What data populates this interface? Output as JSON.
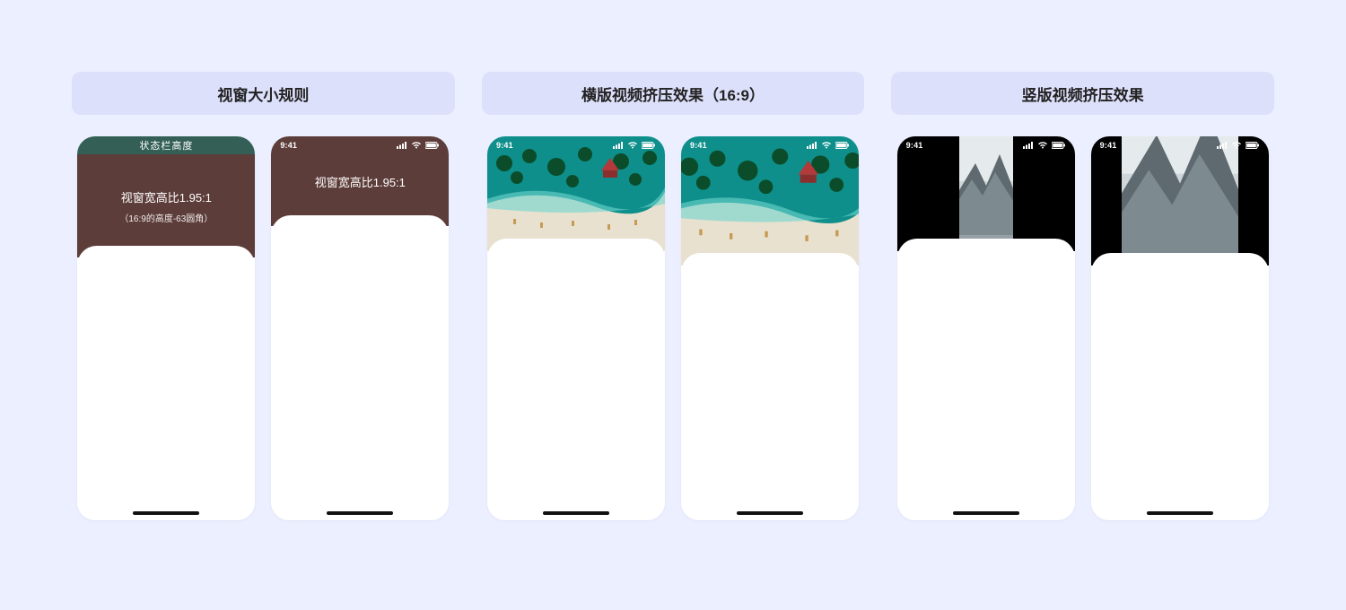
{
  "status_time": "9:41",
  "columns": [
    {
      "title": "视窗大小规则",
      "greenbar_label": "状态栏高度",
      "ratio_label": "视窗宽高比1.95:1",
      "ratio_sub": "（16:9的高度-63圆角）"
    },
    {
      "title": "横版视频挤压效果（16:9）"
    },
    {
      "title": "竖版视频挤压效果"
    }
  ]
}
